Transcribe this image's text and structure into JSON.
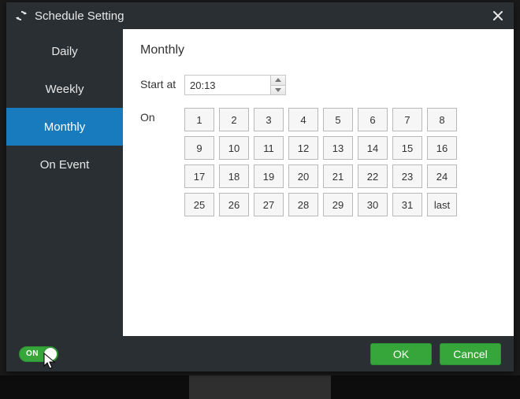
{
  "title": "Schedule Setting",
  "sidebar": {
    "items": [
      {
        "label": "Daily",
        "active": false
      },
      {
        "label": "Weekly",
        "active": false
      },
      {
        "label": "Monthly",
        "active": true
      },
      {
        "label": "On Event",
        "active": false
      }
    ]
  },
  "panel": {
    "heading": "Monthly",
    "start_at_label": "Start at",
    "start_at_value": "20:13",
    "on_label": "On",
    "days": [
      "1",
      "2",
      "3",
      "4",
      "5",
      "6",
      "7",
      "8",
      "9",
      "10",
      "11",
      "12",
      "13",
      "14",
      "15",
      "16",
      "17",
      "18",
      "19",
      "20",
      "21",
      "22",
      "23",
      "24",
      "25",
      "26",
      "27",
      "28",
      "29",
      "30",
      "31",
      "last"
    ]
  },
  "footer": {
    "toggle_state": "ON",
    "ok_label": "OK",
    "cancel_label": "Cancel"
  }
}
